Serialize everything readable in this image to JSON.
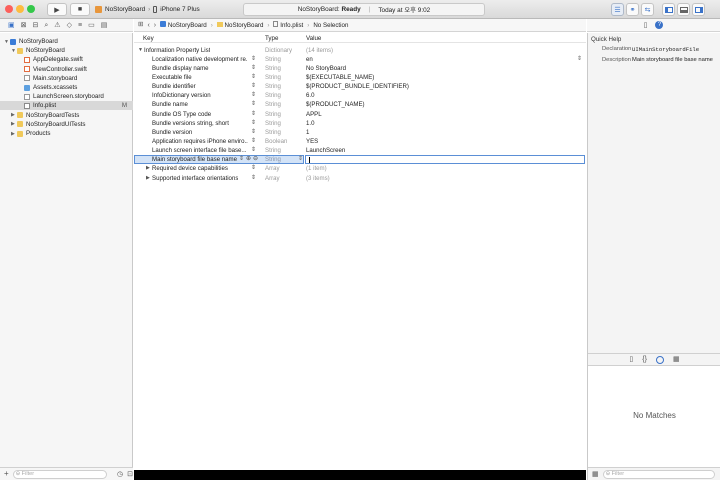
{
  "toolbar": {
    "scheme": "NoStoryBoard",
    "device": "iPhone 7 Plus",
    "status_project": "NoStoryBoard:",
    "status_state": "Ready",
    "status_time": "Today at 오후 9:02"
  },
  "jumpbar": {
    "items": [
      "NoStoryBoard",
      "NoStoryBoard",
      "Info.plist",
      "No Selection"
    ]
  },
  "navigator": {
    "rows": [
      {
        "label": "NoStoryBoard",
        "icon": "project-icon",
        "depth": 0,
        "disclosure": "▼",
        "selected": false,
        "badge": ""
      },
      {
        "label": "NoStoryBoard",
        "icon": "folder-icon",
        "depth": 1,
        "disclosure": "▼",
        "selected": false,
        "badge": ""
      },
      {
        "label": "AppDelegate.swift",
        "icon": "swift-file-icon",
        "depth": 2,
        "disclosure": "",
        "selected": false,
        "badge": ""
      },
      {
        "label": "ViewController.swift",
        "icon": "swift-file-icon",
        "depth": 2,
        "disclosure": "",
        "selected": false,
        "badge": ""
      },
      {
        "label": "Main.storyboard",
        "icon": "storyboard-file-icon",
        "depth": 2,
        "disclosure": "",
        "selected": false,
        "badge": ""
      },
      {
        "label": "Assets.xcassets",
        "icon": "asset-catalog-icon",
        "depth": 2,
        "disclosure": "",
        "selected": false,
        "badge": ""
      },
      {
        "label": "LaunchScreen.storyboard",
        "icon": "storyboard-file-icon",
        "depth": 2,
        "disclosure": "",
        "selected": false,
        "badge": ""
      },
      {
        "label": "Info.plist",
        "icon": "plist-file-icon",
        "depth": 2,
        "disclosure": "",
        "selected": true,
        "badge": "M"
      },
      {
        "label": "NoStoryBoardTests",
        "icon": "folder-icon",
        "depth": 1,
        "disclosure": "▶",
        "selected": false,
        "badge": ""
      },
      {
        "label": "NoStoryBoardUITests",
        "icon": "folder-icon",
        "depth": 1,
        "disclosure": "▶",
        "selected": false,
        "badge": ""
      },
      {
        "label": "Products",
        "icon": "folder-icon",
        "depth": 1,
        "disclosure": "▶",
        "selected": false,
        "badge": ""
      }
    ],
    "filter_placeholder": "Filter"
  },
  "plist": {
    "headers": {
      "key": "Key",
      "type": "Type",
      "value": "Value"
    },
    "rows": [
      {
        "key": "Information Property List",
        "type": "Dictionary",
        "value": "(14 items)",
        "level": 0,
        "disclosure": "▼",
        "stepper": false,
        "dim_value": true,
        "popup": false,
        "selected": false
      },
      {
        "key": "Localization native development re...",
        "type": "String",
        "value": "en",
        "level": 1,
        "disclosure": "",
        "stepper": true,
        "dim_value": false,
        "popup": true,
        "selected": false
      },
      {
        "key": "Bundle display name",
        "type": "String",
        "value": "No StoryBoard",
        "level": 1,
        "disclosure": "",
        "stepper": true,
        "dim_value": false,
        "popup": false,
        "selected": false
      },
      {
        "key": "Executable file",
        "type": "String",
        "value": "$(EXECUTABLE_NAME)",
        "level": 1,
        "disclosure": "",
        "stepper": true,
        "dim_value": false,
        "popup": false,
        "selected": false
      },
      {
        "key": "Bundle identifier",
        "type": "String",
        "value": "$(PRODUCT_BUNDLE_IDENTIFIER)",
        "level": 1,
        "disclosure": "",
        "stepper": true,
        "dim_value": false,
        "popup": false,
        "selected": false
      },
      {
        "key": "InfoDictionary version",
        "type": "String",
        "value": "6.0",
        "level": 1,
        "disclosure": "",
        "stepper": true,
        "dim_value": false,
        "popup": false,
        "selected": false
      },
      {
        "key": "Bundle name",
        "type": "String",
        "value": "$(PRODUCT_NAME)",
        "level": 1,
        "disclosure": "",
        "stepper": true,
        "dim_value": false,
        "popup": false,
        "selected": false
      },
      {
        "key": "Bundle OS Type code",
        "type": "String",
        "value": "APPL",
        "level": 1,
        "disclosure": "",
        "stepper": true,
        "dim_value": false,
        "popup": false,
        "selected": false
      },
      {
        "key": "Bundle versions string, short",
        "type": "String",
        "value": "1.0",
        "level": 1,
        "disclosure": "",
        "stepper": true,
        "dim_value": false,
        "popup": false,
        "selected": false
      },
      {
        "key": "Bundle version",
        "type": "String",
        "value": "1",
        "level": 1,
        "disclosure": "",
        "stepper": true,
        "dim_value": false,
        "popup": false,
        "selected": false
      },
      {
        "key": "Application requires iPhone enviro...",
        "type": "Boolean",
        "value": "YES",
        "level": 1,
        "disclosure": "",
        "stepper": true,
        "dim_value": false,
        "popup": false,
        "selected": false
      },
      {
        "key": "Launch screen interface file base...",
        "type": "String",
        "value": "LaunchScreen",
        "level": 1,
        "disclosure": "",
        "stepper": true,
        "dim_value": false,
        "popup": false,
        "selected": false
      },
      {
        "key": "Main storyboard file base name",
        "type": "String",
        "value": "",
        "level": 1,
        "disclosure": "",
        "stepper": true,
        "dim_value": false,
        "popup": false,
        "selected": true
      },
      {
        "key": "Required device capabilities",
        "type": "Array",
        "value": "(1 item)",
        "level": 1,
        "disclosure": "▶",
        "stepper": true,
        "dim_value": true,
        "popup": false,
        "selected": false
      },
      {
        "key": "Supported interface orientations",
        "type": "Array",
        "value": "(3 items)",
        "level": 1,
        "disclosure": "▶",
        "stepper": true,
        "dim_value": true,
        "popup": false,
        "selected": false
      }
    ]
  },
  "inspector": {
    "title": "Quick Help",
    "declaration_label": "Declaration",
    "declaration_value": "UIMainStoryboardFile",
    "description_label": "Description",
    "description_value": "Main storyboard file base name",
    "no_matches": "No Matches",
    "filter_placeholder": "Filter"
  }
}
